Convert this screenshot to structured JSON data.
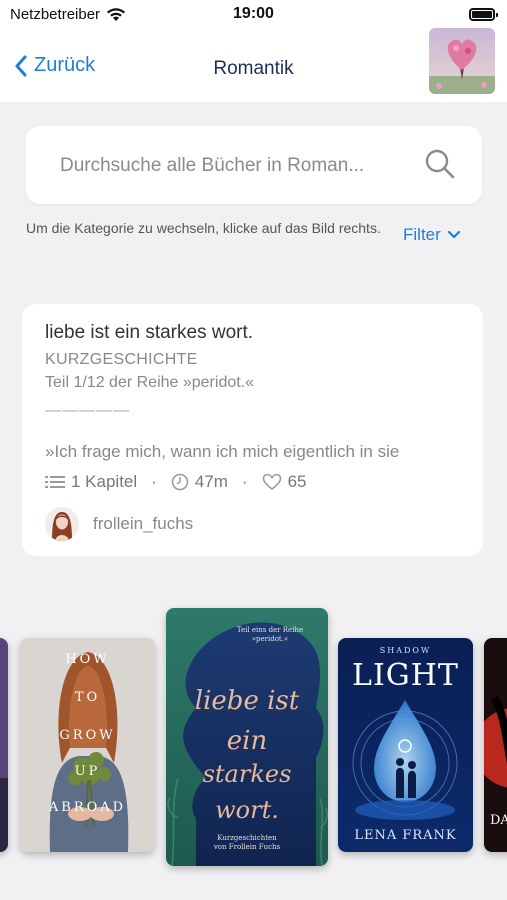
{
  "status": {
    "carrier": "Netzbetreiber",
    "time": "19:00"
  },
  "nav": {
    "back_label": "Zurück",
    "title": "Romantik"
  },
  "search": {
    "placeholder": "Durchsuche alle Bücher in Roman..."
  },
  "hint": "Um die Kategorie zu wechseln, klicke auf das Bild rechts.",
  "filter_label": "Filter",
  "book": {
    "title": "liebe ist ein starkes wort.",
    "type": "KURZGESCHICHTE",
    "series": "Teil 1/12 der Reihe »peridot.«",
    "divider": "—————",
    "excerpt": "»Ich frage mich, wann ich mich eigentlich in sie",
    "chapters": "1 Kapitel",
    "duration": "47m",
    "likes": "65",
    "author": "frollein_fuchs"
  },
  "covers": {
    "how_to": {
      "line1": "HOW",
      "line2": "TO",
      "line3": "GROW",
      "line4": "UP",
      "line5": "ABROAD"
    },
    "liebe": {
      "top_text": "Teil eins der Reihe »peridot.«",
      "line1": "liebe ist",
      "line2": "ein",
      "line3": "starkes",
      "line4": "wort.",
      "bottom": "Kurzgeschichten von Frollein Fuchs"
    },
    "light": {
      "series": "SHADOW",
      "title": "LIGHT",
      "author": "LENA FRANK"
    },
    "partial_right": {
      "text": "DA"
    }
  },
  "colors": {
    "accent": "#1e7fd9",
    "nav_title": "#1c2f5a"
  }
}
